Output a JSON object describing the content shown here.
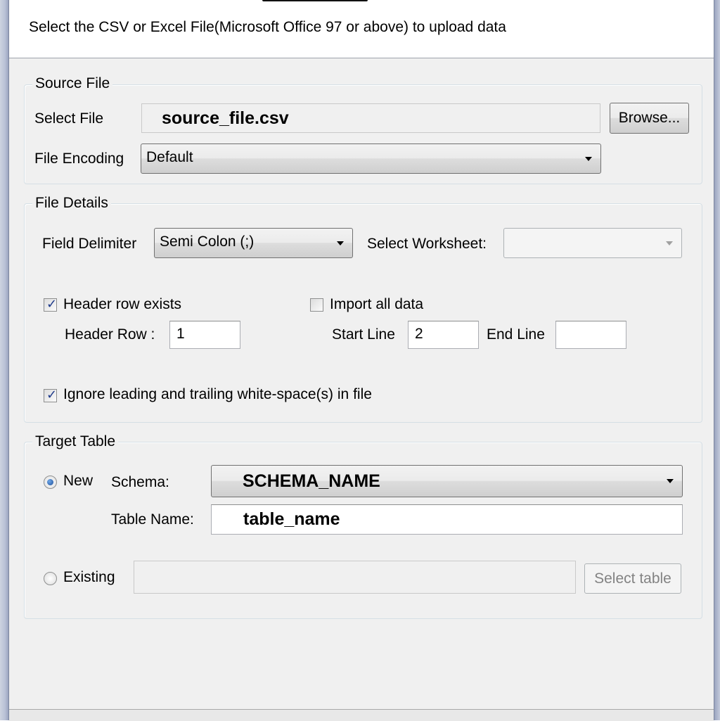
{
  "dialog": {
    "description": "Select the CSV or Excel File(Microsoft Office 97 or above) to upload data"
  },
  "source_file": {
    "legend": "Source File",
    "select_file_label": "Select File",
    "select_file_value": "source_file.csv",
    "browse_label": "Browse...",
    "encoding_label": "File Encoding",
    "encoding_value": "Default"
  },
  "file_details": {
    "legend": "File Details",
    "delimiter_label": "Field Delimiter",
    "delimiter_value": "Semi Colon (;)",
    "worksheet_label": "Select Worksheet:",
    "worksheet_value": "",
    "header_row_exists_label": "Header row exists",
    "header_row_exists_checked": true,
    "header_row_label": "Header Row :",
    "header_row_value": "1",
    "import_all_label": "Import all data",
    "import_all_checked": false,
    "start_line_label": "Start Line",
    "start_line_value": "2",
    "end_line_label": "End Line",
    "end_line_value": "",
    "ignore_whitespace_label": "Ignore leading and trailing white-space(s) in file",
    "ignore_whitespace_checked": true
  },
  "target_table": {
    "legend": "Target Table",
    "new_label": "New",
    "new_selected": true,
    "schema_label": "Schema:",
    "schema_value": "SCHEMA_NAME",
    "table_name_label": "Table Name:",
    "table_name_value": "table_name",
    "existing_label": "Existing",
    "existing_value": "",
    "select_table_label": "Select table"
  }
}
